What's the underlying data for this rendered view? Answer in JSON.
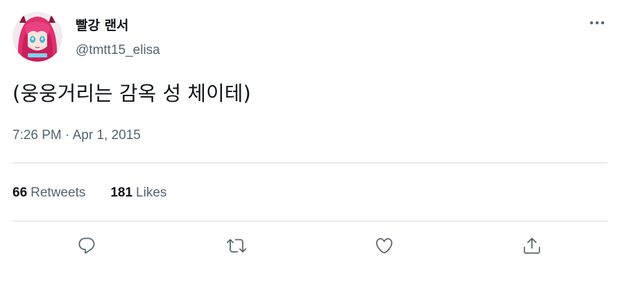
{
  "author": {
    "display_name": "빨강 랜서",
    "handle": "@tmtt15_elisa",
    "avatar_icon": "anime-avatar"
  },
  "tweet": {
    "text": "(웅웅거리는 감옥 성 체이테)",
    "timestamp": "7:26 PM · Apr 1, 2015"
  },
  "stats": {
    "retweets_count": "66",
    "retweets_label": "Retweets",
    "likes_count": "181",
    "likes_label": "Likes"
  },
  "actions": {
    "icons": [
      "reply-icon",
      "retweet-icon",
      "like-icon",
      "share-icon"
    ]
  },
  "colors": {
    "text_primary": "#0f1419",
    "text_secondary": "#536471",
    "divider": "#cfd9de",
    "icon": "#536471"
  }
}
